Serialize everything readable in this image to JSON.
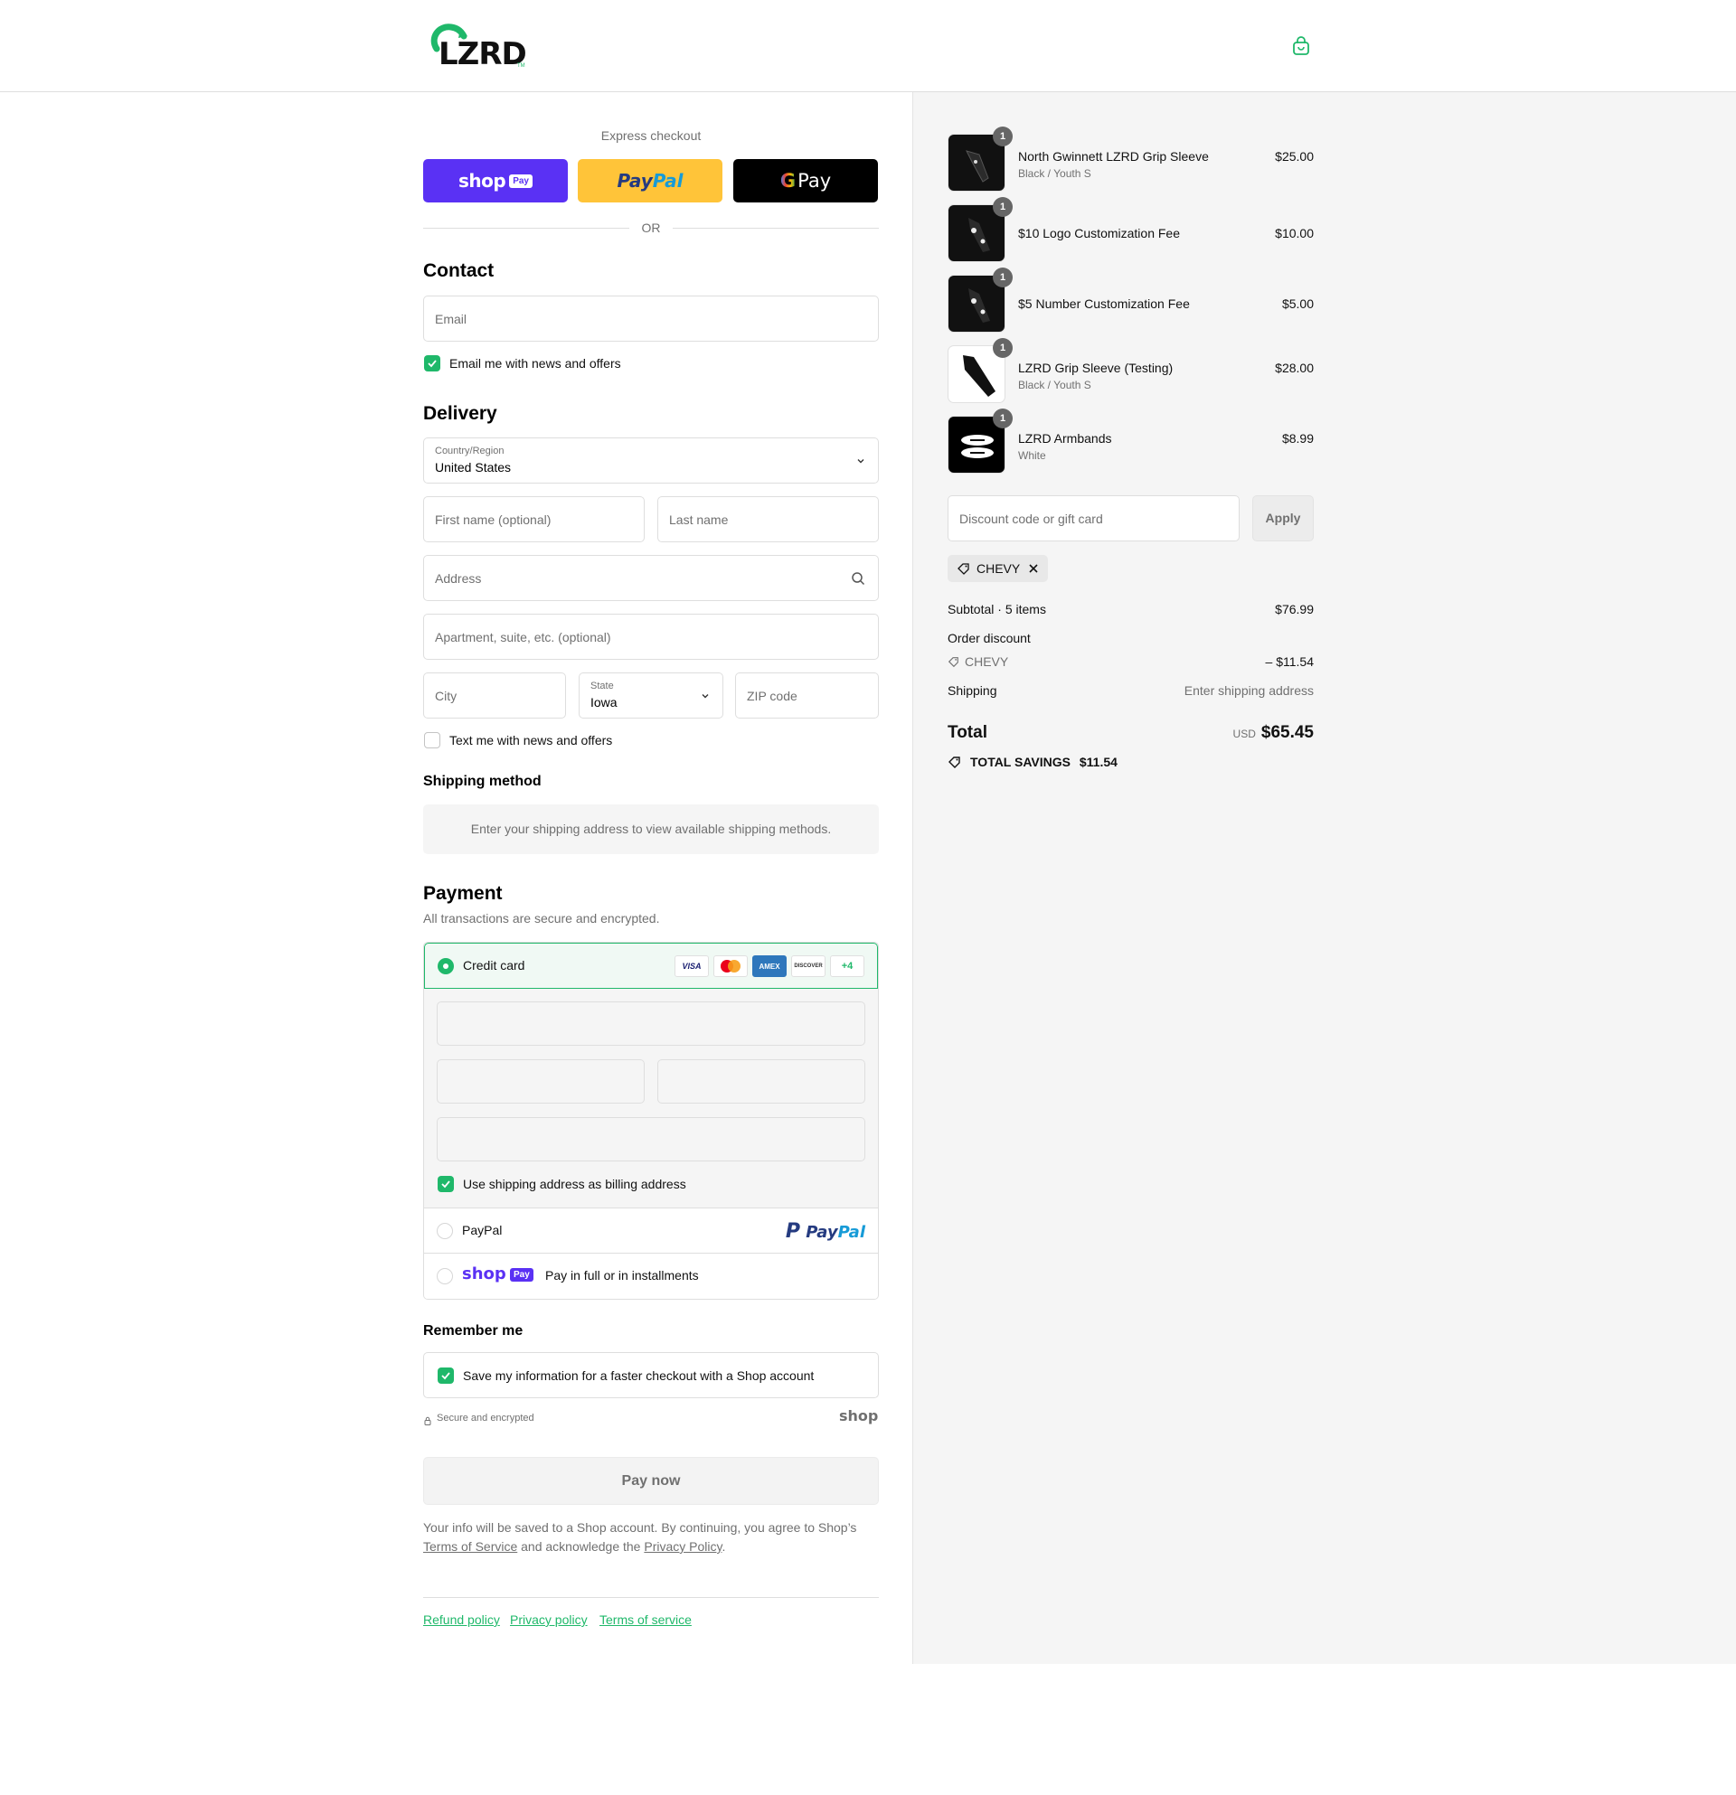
{
  "header": {
    "logo_text": "LZRD",
    "logo_tm": "TM",
    "cart_icon": "shopping-bag-icon"
  },
  "express": {
    "title": "Express checkout",
    "shop_pay": {
      "word": "shop",
      "pill": "Pay"
    },
    "paypal": {
      "part1": "Pay",
      "part2": "Pal"
    },
    "gpay": {
      "g": "G",
      "word": "Pay"
    },
    "or": "OR"
  },
  "contact": {
    "heading": "Contact",
    "email_placeholder": "Email",
    "news_label": "Email me with news and offers",
    "news_checked": true
  },
  "delivery": {
    "heading": "Delivery",
    "country_label": "Country/Region",
    "country_value": "United States",
    "first_name_placeholder": "First name (optional)",
    "last_name_placeholder": "Last name",
    "address_placeholder": "Address",
    "apartment_placeholder": "Apartment, suite, etc. (optional)",
    "city_placeholder": "City",
    "state_label": "State",
    "state_value": "Iowa",
    "zip_placeholder": "ZIP code",
    "text_label": "Text me with news and offers",
    "text_checked": false
  },
  "shipping_method": {
    "heading": "Shipping method",
    "message": "Enter your shipping address to view available shipping methods."
  },
  "payment": {
    "heading": "Payment",
    "subtitle": "All transactions are secure and encrypted.",
    "credit_card_label": "Credit card",
    "card_brands": [
      "VISA",
      "Mastercard",
      "AMEX",
      "DISCOVER"
    ],
    "more_cards": "+4",
    "billing_label": "Use shipping address as billing address",
    "paypal_label": "PayPal",
    "paypal_logo": {
      "part1": "Pay",
      "part2": "Pal"
    },
    "shoppay_logo": {
      "word": "shop",
      "pill": "Pay"
    },
    "shoppay_label": "Pay in full or in installments"
  },
  "remember": {
    "heading": "Remember me",
    "save_label": "Save my information for a faster checkout with a Shop account",
    "secure_label": "Secure and encrypted",
    "shop_logo": "shop"
  },
  "pay_now": "Pay now",
  "legal": {
    "text1": "Your info will be saved to a Shop account. By continuing, you agree to Shop’s ",
    "tos": "Terms of Service",
    "text2": " and acknowledge the ",
    "privacy": "Privacy Policy",
    "text3": "."
  },
  "footer": {
    "refund": "Refund policy",
    "privacy": "Privacy policy",
    "terms": "Terms of service"
  },
  "summary": {
    "items": [
      {
        "name": "North Gwinnett LZRD Grip Sleeve",
        "variant": "Black / Youth S",
        "price": "$25.00",
        "qty": "1"
      },
      {
        "name": "$10 Logo Customization Fee",
        "variant": "",
        "price": "$10.00",
        "qty": "1"
      },
      {
        "name": "$5 Number Customization Fee",
        "variant": "",
        "price": "$5.00",
        "qty": "1"
      },
      {
        "name": "LZRD Grip Sleeve (Testing)",
        "variant": "Black / Youth S",
        "price": "$28.00",
        "qty": "1"
      },
      {
        "name": "LZRD Armbands",
        "variant": "White",
        "price": "$8.99",
        "qty": "1"
      }
    ],
    "discount_placeholder": "Discount code or gift card",
    "apply_label": "Apply",
    "code_chip": "CHEVY",
    "subtotal_label": "Subtotal · 5 items",
    "subtotal_value": "$76.99",
    "order_discount_label": "Order discount",
    "discount_code": "CHEVY",
    "discount_value": "– $11.54",
    "shipping_label": "Shipping",
    "shipping_value": "Enter shipping address",
    "total_label": "Total",
    "currency": "USD",
    "total_value": "$65.45",
    "savings_label": "TOTAL SAVINGS",
    "savings_value": "$11.54"
  },
  "colors": {
    "accent": "#1fb86a",
    "shop_purple": "#5a31f4",
    "paypal_yellow": "#ffc439",
    "summary_bg": "#f5f5f5"
  }
}
